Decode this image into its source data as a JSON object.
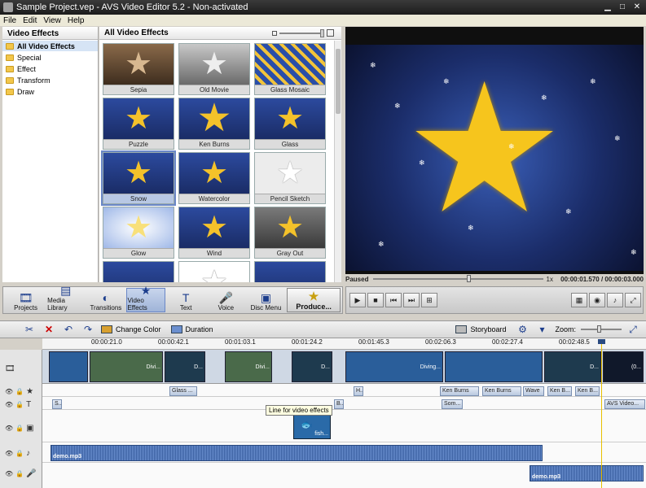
{
  "window": {
    "title": "Sample Project.vep - AVS Video Editor 5.2 - Non-activated"
  },
  "menu": [
    "File",
    "Edit",
    "View",
    "Help"
  ],
  "categories": {
    "header": "Video Effects",
    "items": [
      "All Video Effects",
      "Special",
      "Effect",
      "Transform",
      "Draw"
    ]
  },
  "effects": {
    "header": "All Video Effects",
    "tiles": [
      {
        "label": "Sepia"
      },
      {
        "label": "Old Movie"
      },
      {
        "label": "Glass Mosaic"
      },
      {
        "label": "Puzzle"
      },
      {
        "label": "Ken Burns"
      },
      {
        "label": "Glass"
      },
      {
        "label": "Snow"
      },
      {
        "label": "Watercolor"
      },
      {
        "label": "Pencil Sketch"
      },
      {
        "label": "Glow"
      },
      {
        "label": "Wind"
      },
      {
        "label": "Gray Out"
      }
    ]
  },
  "preview": {
    "state": "Paused",
    "speed": "1x",
    "current_time": "00:00:01.570",
    "total_time": "00:00:03.000"
  },
  "toolbar": {
    "projects": "Projects",
    "media_library": "Media Library",
    "transitions": "Transitions",
    "video_effects": "Video Effects",
    "text": "Text",
    "voice": "Voice",
    "disc_menu": "Disc Menu",
    "produce": "Produce..."
  },
  "timeline": {
    "change_color": "Change Color",
    "duration": "Duration",
    "storyboard": "Storyboard",
    "zoom": "Zoom:",
    "ruler": [
      "00:00:21.0",
      "00:00:42.1",
      "00:01:03.1",
      "00:01:24.2",
      "00:01:45.3",
      "00:02:06.3",
      "00:02:27.4",
      "00:02:48.5"
    ],
    "video_clip_labels": [
      "Divi...",
      "D...",
      "Divi...",
      "D...",
      "Diving...",
      "D...",
      "(0..."
    ],
    "fx_chips": [
      "Glass ...",
      "H...",
      "Ken Burns",
      "Ken Burns",
      "Wave",
      "Ken B...",
      "Ken B..."
    ],
    "text_chips": [
      "S...",
      "B...",
      "Som...",
      "AVS Video..."
    ],
    "overlay_clip": "fish...",
    "audio1": "demo.mp3",
    "audio2": "demo.mp3",
    "tooltip": "Line for video effects"
  }
}
